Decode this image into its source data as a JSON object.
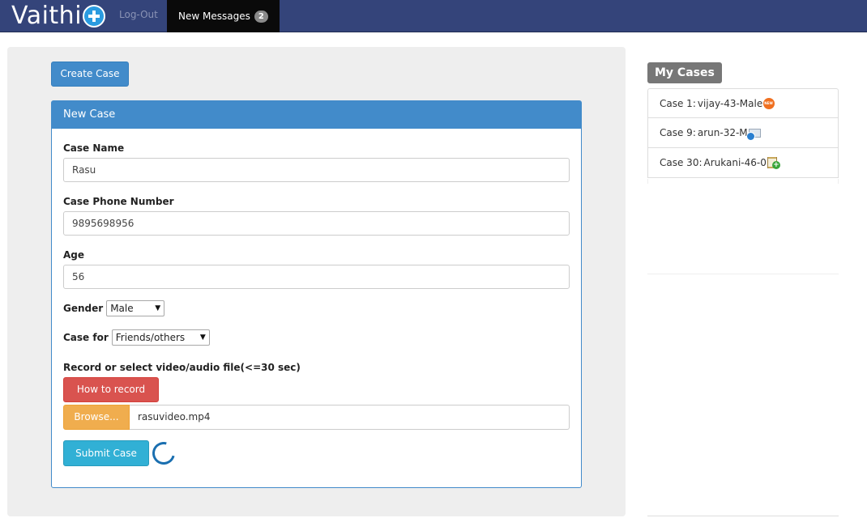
{
  "nav": {
    "brand": "Vaithi",
    "logout": "Log-Out",
    "messages_label": "New Messages",
    "messages_count": "2"
  },
  "main": {
    "create_button": "Create Case",
    "panel_title": "New Case",
    "form": {
      "case_name_label": "Case Name",
      "case_name_value": "Rasu",
      "phone_label": "Case Phone Number",
      "phone_value": "9895698956",
      "age_label": "Age",
      "age_value": "56",
      "gender_label": "Gender",
      "gender_value": "Male",
      "case_for_label": "Case for",
      "case_for_value": "Friends/others",
      "record_label": "Record or select video/audio file(<=30 sec)",
      "how_to_record_button": "How to record",
      "browse_button": "Browse...",
      "file_name": "rasuvideo.mp4",
      "submit_button": "Submit Case"
    }
  },
  "sidebar": {
    "title": "My Cases",
    "cases": [
      {
        "id": "Case 1:",
        "label": "vijay-43-Male",
        "icon": "new-icon"
      },
      {
        "id": "Case 9:",
        "label": "arun-32-M",
        "icon": "mail-icon"
      },
      {
        "id": "Case 30:",
        "label": "Arukani-46-0",
        "icon": "hourglass-icon"
      }
    ]
  },
  "colors": {
    "navbar": "#34447a",
    "primary": "#428bca",
    "danger": "#d9534f",
    "warning": "#f0ad4e",
    "info": "#31b0d5"
  }
}
